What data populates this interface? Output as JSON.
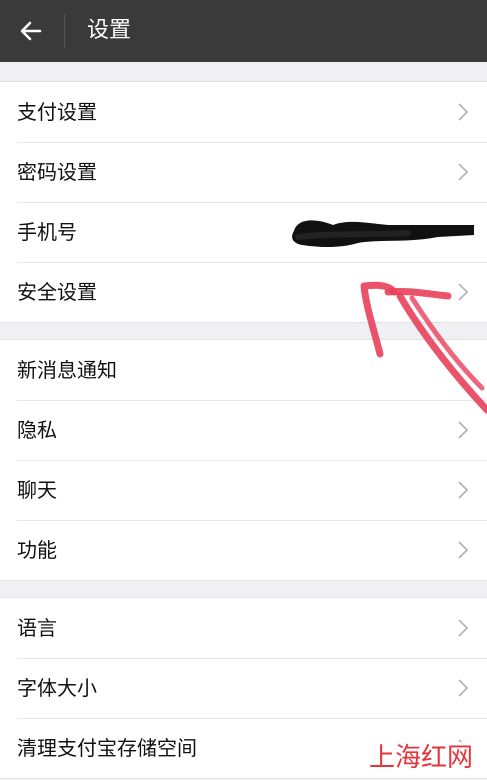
{
  "header": {
    "title": "设置",
    "background": "#3a3a3a"
  },
  "groups": [
    {
      "items": [
        {
          "label": "支付设置",
          "chevron": true
        },
        {
          "label": "密码设置",
          "chevron": true
        },
        {
          "label": "手机号",
          "chevron": false,
          "value_redacted": true
        },
        {
          "label": "安全设置",
          "chevron": true
        }
      ]
    },
    {
      "items": [
        {
          "label": "新消息通知",
          "chevron": false
        },
        {
          "label": "隐私",
          "chevron": true
        },
        {
          "label": "聊天",
          "chevron": true
        },
        {
          "label": "功能",
          "chevron": true
        }
      ]
    },
    {
      "items": [
        {
          "label": "语言",
          "chevron": true
        },
        {
          "label": "字体大小",
          "chevron": true
        },
        {
          "label": "清理支付宝存储空间",
          "chevron": true
        }
      ]
    }
  ],
  "watermark": "上海红网",
  "annotation_color": "#e8405a"
}
